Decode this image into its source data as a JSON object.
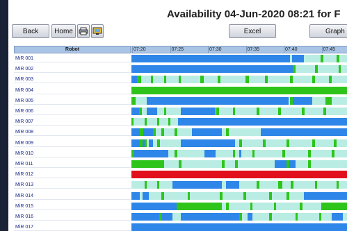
{
  "page": {
    "title": "Availability 04-Jun-2020 08:21 for F"
  },
  "toolbar": {
    "back_label": "Back",
    "home_label": "Home",
    "print_icon": "printer-icon",
    "view_icon": "screen-icon",
    "excel_label": "Excel",
    "graph_label": "Graph"
  },
  "table": {
    "robot_header": "Robot",
    "time_labels": [
      "07:20",
      "07:25",
      "07:30",
      "07:35",
      "07:40",
      "07:45"
    ],
    "colors": {
      "idle": "#b9ece3",
      "blue": "#2e86e8",
      "green": "#2ec41a",
      "red": "#e1101c"
    },
    "rows": [
      {
        "name": "MiR 001",
        "segments": [
          [
            "blue",
            0.0,
            0.736
          ],
          [
            "blue",
            0.745,
            0.8
          ],
          [
            "green",
            0.878,
            0.89
          ],
          [
            "green",
            0.952,
            0.963
          ]
        ]
      },
      {
        "name": "MiR 002",
        "segments": [
          [
            "blue",
            0.0,
            0.748
          ],
          [
            "green",
            0.748,
            0.76
          ],
          [
            "green",
            0.852,
            0.864
          ],
          [
            "green",
            0.96,
            0.972
          ]
        ]
      },
      {
        "name": "MiR 003",
        "segments": [
          [
            "blue",
            0.0,
            0.025
          ],
          [
            "green",
            0.025,
            0.045
          ],
          [
            "green",
            0.09,
            0.1
          ],
          [
            "green",
            0.15,
            0.16
          ],
          [
            "green",
            0.22,
            0.23
          ],
          [
            "green",
            0.32,
            0.335
          ],
          [
            "green",
            0.4,
            0.412
          ],
          [
            "green",
            0.528,
            0.545
          ],
          [
            "green",
            0.62,
            0.632
          ],
          [
            "green",
            0.735,
            0.748
          ],
          [
            "green",
            0.84,
            0.852
          ],
          [
            "green",
            0.915,
            0.928
          ]
        ]
      },
      {
        "name": "MiR 004",
        "segments": [
          [
            "green",
            0.0,
            1.0
          ]
        ]
      },
      {
        "name": "MiR 005",
        "segments": [
          [
            "green",
            0.0,
            0.02
          ],
          [
            "blue",
            0.07,
            0.73
          ],
          [
            "green",
            0.735,
            0.748
          ],
          [
            "blue",
            0.748,
            0.84
          ],
          [
            "green",
            0.9,
            0.93
          ]
        ]
      },
      {
        "name": "MiR 006",
        "segments": [
          [
            "blue",
            0.0,
            0.035
          ],
          [
            "green",
            0.035,
            0.048
          ],
          [
            "blue",
            0.07,
            0.12
          ],
          [
            "green",
            0.15,
            0.162
          ],
          [
            "blue",
            0.23,
            0.39
          ],
          [
            "green",
            0.395,
            0.408
          ],
          [
            "green",
            0.47,
            0.482
          ],
          [
            "green",
            0.58,
            0.592
          ],
          [
            "green",
            0.68,
            0.692
          ],
          [
            "green",
            0.79,
            0.802
          ],
          [
            "green",
            0.89,
            0.902
          ]
        ]
      },
      {
        "name": "MiR 007",
        "segments": [
          [
            "green",
            0.0,
            0.01
          ],
          [
            "green",
            0.06,
            0.07
          ],
          [
            "green",
            0.12,
            0.13
          ],
          [
            "green",
            0.17,
            0.18
          ],
          [
            "blue",
            0.215,
            1.0
          ]
        ]
      },
      {
        "name": "MiR 008",
        "segments": [
          [
            "blue",
            0.0,
            0.04
          ],
          [
            "green",
            0.04,
            0.055
          ],
          [
            "blue",
            0.055,
            0.1
          ],
          [
            "green",
            0.1,
            0.112
          ],
          [
            "green",
            0.14,
            0.152
          ],
          [
            "green",
            0.2,
            0.212
          ],
          [
            "blue",
            0.28,
            0.42
          ],
          [
            "green",
            0.44,
            0.452
          ],
          [
            "blue",
            0.6,
            1.0
          ]
        ]
      },
      {
        "name": "MiR 009",
        "segments": [
          [
            "blue",
            0.0,
            0.04
          ],
          [
            "green",
            0.04,
            0.052
          ],
          [
            "blue",
            0.052,
            0.06
          ],
          [
            "green",
            0.06,
            0.072
          ],
          [
            "blue",
            0.08,
            0.1
          ],
          [
            "green",
            0.12,
            0.132
          ],
          [
            "blue",
            0.23,
            0.48
          ],
          [
            "green",
            0.5,
            0.512
          ],
          [
            "green",
            0.61,
            0.622
          ],
          [
            "green",
            0.72,
            0.732
          ],
          [
            "green",
            0.84,
            0.852
          ],
          [
            "green",
            0.94,
            0.952
          ]
        ]
      },
      {
        "name": "MiR 010",
        "segments": [
          [
            "green",
            0.0,
            0.012
          ],
          [
            "blue",
            0.012,
            0.17
          ],
          [
            "green",
            0.2,
            0.212
          ],
          [
            "blue",
            0.34,
            0.39
          ],
          [
            "green",
            0.47,
            0.482
          ],
          [
            "blue",
            0.5,
            0.51
          ],
          [
            "green",
            0.56,
            0.572
          ],
          [
            "green",
            0.7,
            0.712
          ],
          [
            "green",
            0.82,
            0.832
          ],
          [
            "green",
            0.93,
            0.942
          ]
        ]
      },
      {
        "name": "MiR 011",
        "segments": [
          [
            "green",
            0.0,
            0.15
          ],
          [
            "green",
            0.22,
            0.232
          ],
          [
            "green",
            0.42,
            0.432
          ],
          [
            "green",
            0.48,
            0.492
          ],
          [
            "blue",
            0.665,
            0.72
          ],
          [
            "green",
            0.72,
            0.732
          ],
          [
            "blue",
            0.732,
            0.76
          ],
          [
            "green",
            0.82,
            0.832
          ]
        ]
      },
      {
        "name": "MiR 012",
        "segments": [
          [
            "red",
            0.0,
            1.0
          ]
        ]
      },
      {
        "name": "MiR 013",
        "segments": [
          [
            "green",
            0.06,
            0.07
          ],
          [
            "green",
            0.12,
            0.13
          ],
          [
            "blue",
            0.19,
            0.42
          ],
          [
            "blue",
            0.44,
            0.5
          ],
          [
            "green",
            0.58,
            0.592
          ],
          [
            "green",
            0.68,
            0.7
          ],
          [
            "green",
            0.74,
            0.752
          ],
          [
            "green",
            0.85,
            0.862
          ],
          [
            "green",
            0.95,
            0.962
          ]
        ]
      },
      {
        "name": "MiR 014",
        "segments": [
          [
            "blue",
            0.0,
            0.04
          ],
          [
            "blue",
            0.05,
            0.08
          ],
          [
            "green",
            0.14,
            0.152
          ],
          [
            "green",
            0.26,
            0.272
          ],
          [
            "green",
            0.41,
            0.422
          ],
          [
            "green",
            0.52,
            0.532
          ],
          [
            "green",
            0.64,
            0.652
          ],
          [
            "green",
            0.72,
            0.732
          ],
          [
            "blue",
            0.8,
            1.0
          ]
        ]
      },
      {
        "name": "MiR 015",
        "segments": [
          [
            "blue",
            0.0,
            0.21
          ],
          [
            "green",
            0.21,
            0.42
          ],
          [
            "green",
            0.44,
            0.452
          ],
          [
            "green",
            0.55,
            0.562
          ],
          [
            "green",
            0.66,
            0.672
          ],
          [
            "green",
            0.78,
            0.792
          ],
          [
            "green",
            0.88,
            1.0
          ]
        ]
      },
      {
        "name": "MiR 016",
        "segments": [
          [
            "blue",
            0.0,
            0.19
          ],
          [
            "green",
            0.13,
            0.142
          ],
          [
            "blue",
            0.23,
            0.5
          ],
          [
            "green",
            0.5,
            0.512
          ],
          [
            "blue",
            0.54,
            0.56
          ],
          [
            "green",
            0.64,
            0.652
          ],
          [
            "green",
            0.76,
            0.772
          ],
          [
            "green",
            0.87,
            0.882
          ],
          [
            "blue",
            0.93,
            0.98
          ]
        ]
      },
      {
        "name": "MiR 017",
        "segments": [
          [
            "blue",
            0.0,
            1.0
          ]
        ]
      }
    ]
  }
}
